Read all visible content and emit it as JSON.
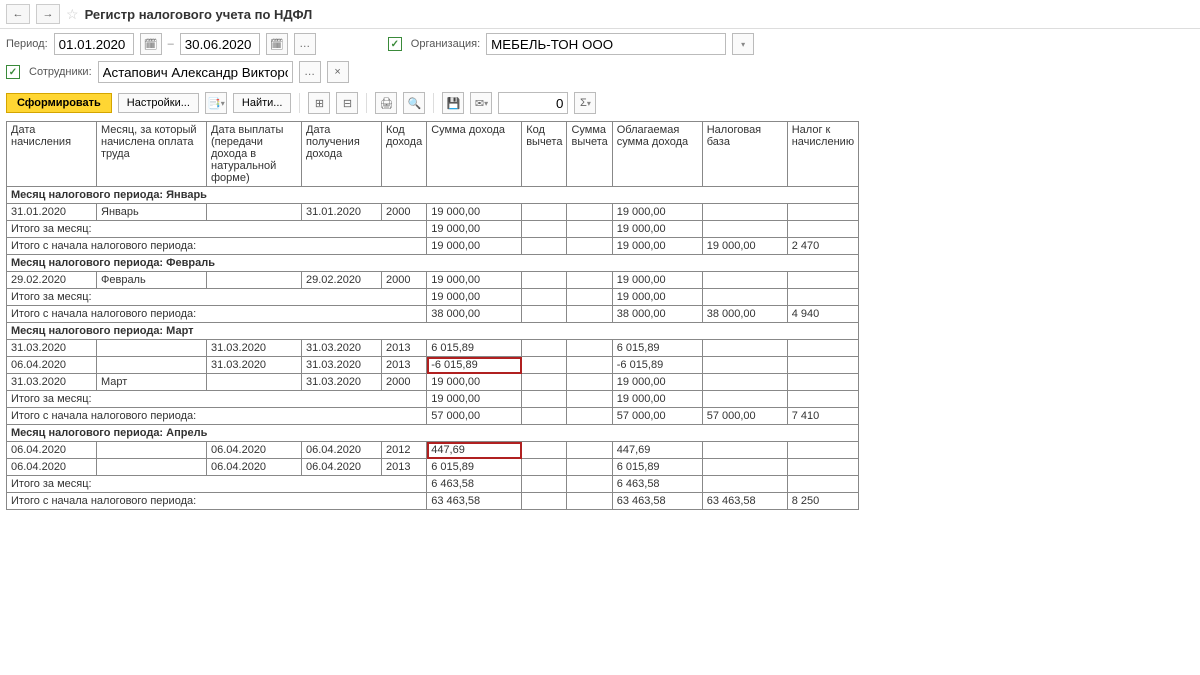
{
  "header": {
    "title": "Регистр налогового учета по НДФЛ"
  },
  "filters": {
    "period_label": "Период:",
    "date_from": "01.01.2020",
    "date_to": "30.06.2020",
    "dash": "–",
    "org_label": "Организация:",
    "org_value": "МЕБЕЛЬ-ТОН ООО",
    "emp_label": "Сотрудники:",
    "emp_value": "Астапович Александр Викторович"
  },
  "toolbar": {
    "generate": "Сформировать",
    "settings": "Настройки...",
    "find": "Найти...",
    "zero": "0"
  },
  "columns": [
    "Дата начисления",
    "Месяц, за который начислена оплата труда",
    "Дата выплаты (передачи дохода в натуральной форме)",
    "Дата получения дохода",
    "Код дохода",
    "Сумма дохода",
    "Код вычета",
    "Сумма вычета",
    "Облагаемая сумма дохода",
    "Налоговая база",
    "Налог к начислению"
  ],
  "groups": [
    {
      "title": "Месяц налогового периода: Январь",
      "rows": [
        {
          "c0": "31.01.2020",
          "c1": "Январь",
          "c2": "",
          "c3": "31.01.2020",
          "c4": "2000",
          "c5": "19 000,00",
          "c6": "",
          "c7": "",
          "c8": "19 000,00",
          "c9": "",
          "c10": ""
        }
      ],
      "month_total": {
        "label": "Итого за месяц:",
        "c5": "19 000,00",
        "c8": "19 000,00"
      },
      "period_total": {
        "label": "Итого с начала налогового периода:",
        "c5": "19 000,00",
        "c8": "19 000,00",
        "c9": "19 000,00",
        "c10": "2 470"
      }
    },
    {
      "title": "Месяц налогового периода: Февраль",
      "rows": [
        {
          "c0": "29.02.2020",
          "c1": "Февраль",
          "c2": "",
          "c3": "29.02.2020",
          "c4": "2000",
          "c5": "19 000,00",
          "c6": "",
          "c7": "",
          "c8": "19 000,00",
          "c9": "",
          "c10": ""
        }
      ],
      "month_total": {
        "label": "Итого за месяц:",
        "c5": "19 000,00",
        "c8": "19 000,00"
      },
      "period_total": {
        "label": "Итого с начала налогового периода:",
        "c5": "38 000,00",
        "c8": "38 000,00",
        "c9": "38 000,00",
        "c10": "4 940"
      }
    },
    {
      "title": "Месяц налогового периода: Март",
      "rows": [
        {
          "c0": "31.03.2020",
          "c1": "",
          "c2": "31.03.2020",
          "c3": "31.03.2020",
          "c4": "2013",
          "c5": "6 015,89",
          "c6": "",
          "c7": "",
          "c8": "6 015,89",
          "c9": "",
          "c10": ""
        },
        {
          "c0": "06.04.2020",
          "c1": "",
          "c2": "31.03.2020",
          "c3": "31.03.2020",
          "c4": "2013",
          "c5": "-6 015,89",
          "c5_hl": true,
          "c6": "",
          "c7": "",
          "c8": "-6 015,89",
          "c9": "",
          "c10": ""
        },
        {
          "c0": "31.03.2020",
          "c1": "Март",
          "c2": "",
          "c3": "31.03.2020",
          "c4": "2000",
          "c5": "19 000,00",
          "c6": "",
          "c7": "",
          "c8": "19 000,00",
          "c9": "",
          "c10": ""
        }
      ],
      "month_total": {
        "label": "Итого за месяц:",
        "c5": "19 000,00",
        "c8": "19 000,00"
      },
      "period_total": {
        "label": "Итого с начала налогового периода:",
        "c5": "57 000,00",
        "c8": "57 000,00",
        "c9": "57 000,00",
        "c10": "7 410"
      }
    },
    {
      "title": "Месяц налогового периода: Апрель",
      "rows": [
        {
          "c0": "06.04.2020",
          "c1": "",
          "c2": "06.04.2020",
          "c3": "06.04.2020",
          "c4": "2012",
          "c5": "447,69",
          "c5_hl": true,
          "c6": "",
          "c7": "",
          "c8": "447,69",
          "c9": "",
          "c10": ""
        },
        {
          "c0": "06.04.2020",
          "c1": "",
          "c2": "06.04.2020",
          "c3": "06.04.2020",
          "c4": "2013",
          "c5": "6 015,89",
          "c6": "",
          "c7": "",
          "c8": "6 015,89",
          "c9": "",
          "c10": ""
        }
      ],
      "month_total": {
        "label": "Итого за месяц:",
        "c5": "6 463,58",
        "c8": "6 463,58"
      },
      "period_total": {
        "label": "Итого с начала налогового периода:",
        "c5": "63 463,58",
        "c8": "63 463,58",
        "c9": "63 463,58",
        "c10": "8 250"
      }
    }
  ]
}
